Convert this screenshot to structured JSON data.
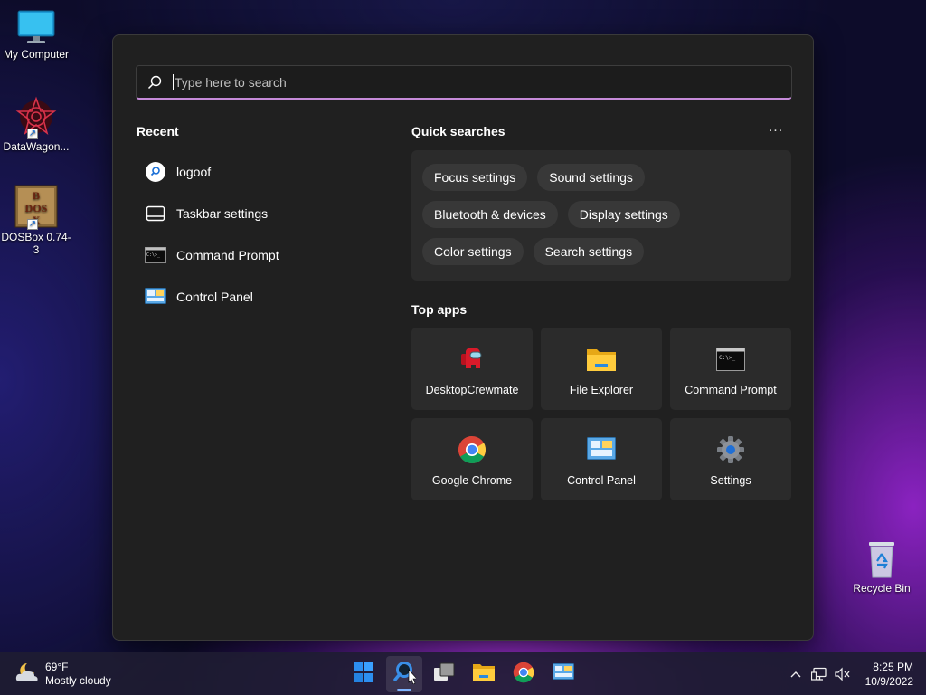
{
  "desktop": {
    "icons": [
      {
        "label": "My Computer"
      },
      {
        "label": "DataWagon..."
      },
      {
        "label": "DOSBox 0.74-3"
      },
      {
        "label": "Recycle Bin"
      }
    ]
  },
  "search": {
    "placeholder": "Type here to search"
  },
  "recent": {
    "title": "Recent",
    "items": [
      {
        "label": "logoof",
        "icon": "search-icon"
      },
      {
        "label": "Taskbar settings",
        "icon": "taskbar-icon"
      },
      {
        "label": "Command Prompt",
        "icon": "command-prompt-icon"
      },
      {
        "label": "Control Panel",
        "icon": "control-panel-icon"
      }
    ]
  },
  "quick_searches": {
    "title": "Quick searches",
    "more": "...",
    "chips": [
      [
        "Focus settings",
        "Sound settings"
      ],
      [
        "Bluetooth & devices",
        "Display settings"
      ],
      [
        "Color settings",
        "Search settings"
      ]
    ]
  },
  "top_apps": {
    "title": "Top apps",
    "apps": [
      {
        "label": "DesktopCrewmate",
        "icon": "crewmate-icon"
      },
      {
        "label": "File Explorer",
        "icon": "folder-icon"
      },
      {
        "label": "Command Prompt",
        "icon": "command-prompt-icon"
      },
      {
        "label": "Google Chrome",
        "icon": "chrome-icon"
      },
      {
        "label": "Control Panel",
        "icon": "control-panel-icon"
      },
      {
        "label": "Settings",
        "icon": "gear-icon"
      }
    ]
  },
  "taskbar": {
    "weather": {
      "temp": "69°F",
      "condition": "Mostly cloudy"
    },
    "time": "8:25 PM",
    "date": "10/9/2022",
    "apps": [
      "start",
      "search",
      "task-view",
      "file-explorer",
      "chrome",
      "control-panel"
    ]
  },
  "colors": {
    "accent": "#c58ad9",
    "panel_bg": "#202020",
    "tile_bg": "#2b2b2b",
    "chip_bg": "#383838"
  }
}
